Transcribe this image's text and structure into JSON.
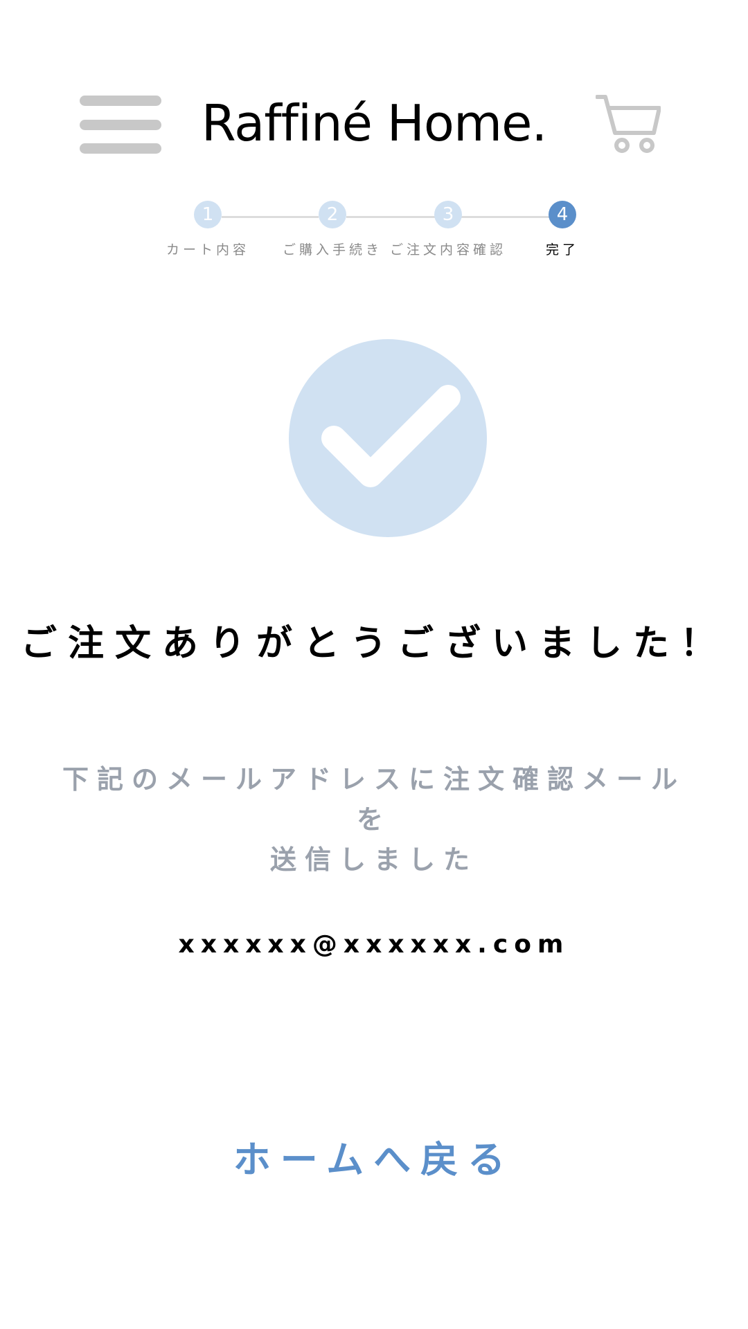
{
  "header": {
    "menu_icon": "hamburger-menu-icon",
    "brand": "Raffiné Home.",
    "cart_icon": "shopping-cart-icon"
  },
  "stepper": {
    "current_step": 4,
    "steps": [
      {
        "number": "1",
        "label": "カート内容"
      },
      {
        "number": "2",
        "label": "ご購入手続き"
      },
      {
        "number": "3",
        "label": "ご注文内容確認"
      },
      {
        "number": "4",
        "label": "完了"
      }
    ]
  },
  "success_icon": "check-circle-icon",
  "main": {
    "thanks_message": "ご注文ありがとうございました！",
    "info_line1": "下記のメールアドレスに注文確認メールを",
    "info_line2": "送信しました",
    "email": "xxxxxx@xxxxxx.com",
    "home_link": "ホームへ戻る"
  },
  "colors": {
    "accent": "#5b8fca",
    "accent_light": "#d0e1f2",
    "icon_gray": "#c8c8c8",
    "muted_text": "#9aa1ac"
  }
}
